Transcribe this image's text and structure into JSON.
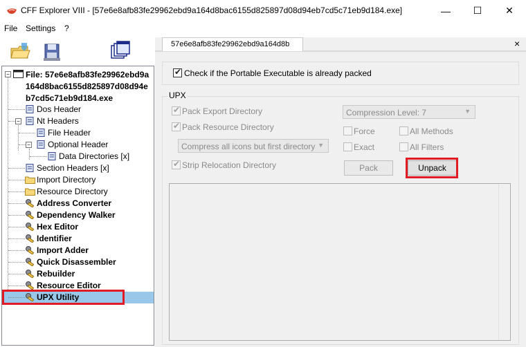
{
  "window": {
    "title": "CFF Explorer VIII - [57e6e8afb83fe29962ebd9a164d8bac6155d825897d08d94eb7cd5c71eb9d184.exe]",
    "minimize": "—",
    "maximize": "☐",
    "close": "✕"
  },
  "menu": [
    "File",
    "Settings",
    "?"
  ],
  "toolbar": {
    "icons": [
      "open-folder-icon",
      "save-disk-icon",
      "windows-icon"
    ]
  },
  "tree": {
    "root_line1": "File: 57e6e8afb83fe29962ebd9a",
    "root_line2": "164d8bac6155d825897d08d94e",
    "root_line3": "b7cd5c71eb9d184.exe",
    "items": [
      "Dos Header",
      "Nt Headers",
      "File Header",
      "Optional Header",
      "Data Directories [x]",
      "Section Headers [x]",
      "Import Directory",
      "Resource Directory",
      "Address Converter",
      "Dependency Walker",
      "Hex Editor",
      "Identifier",
      "Import Adder",
      "Quick Disassembler",
      "Rebuilder",
      "Resource Editor",
      "UPX Utility"
    ],
    "selected": "UPX Utility"
  },
  "tab": {
    "label": "57e6e8afb83fe29962ebd9a164d8b",
    "close": "×"
  },
  "upx": {
    "check_packed_label": "Check if the Portable Executable is already packed",
    "group_label": "UPX",
    "pack_export_label": "Pack Export Directory",
    "pack_resource_label": "Pack Resource Directory",
    "compress_icons_option": "Compress all icons but first directory",
    "strip_reloc_label": "Strip Relocation Directory",
    "compression_level": "Compression Level: 7",
    "force_label": "Force",
    "all_methods_label": "All Methods",
    "exact_label": "Exact",
    "all_filters_label": "All Filters",
    "pack_button": "Pack",
    "unpack_button": "Unpack"
  },
  "colors": {
    "highlight_red": "#e01b24",
    "selection_blue": "#99c7ea"
  }
}
